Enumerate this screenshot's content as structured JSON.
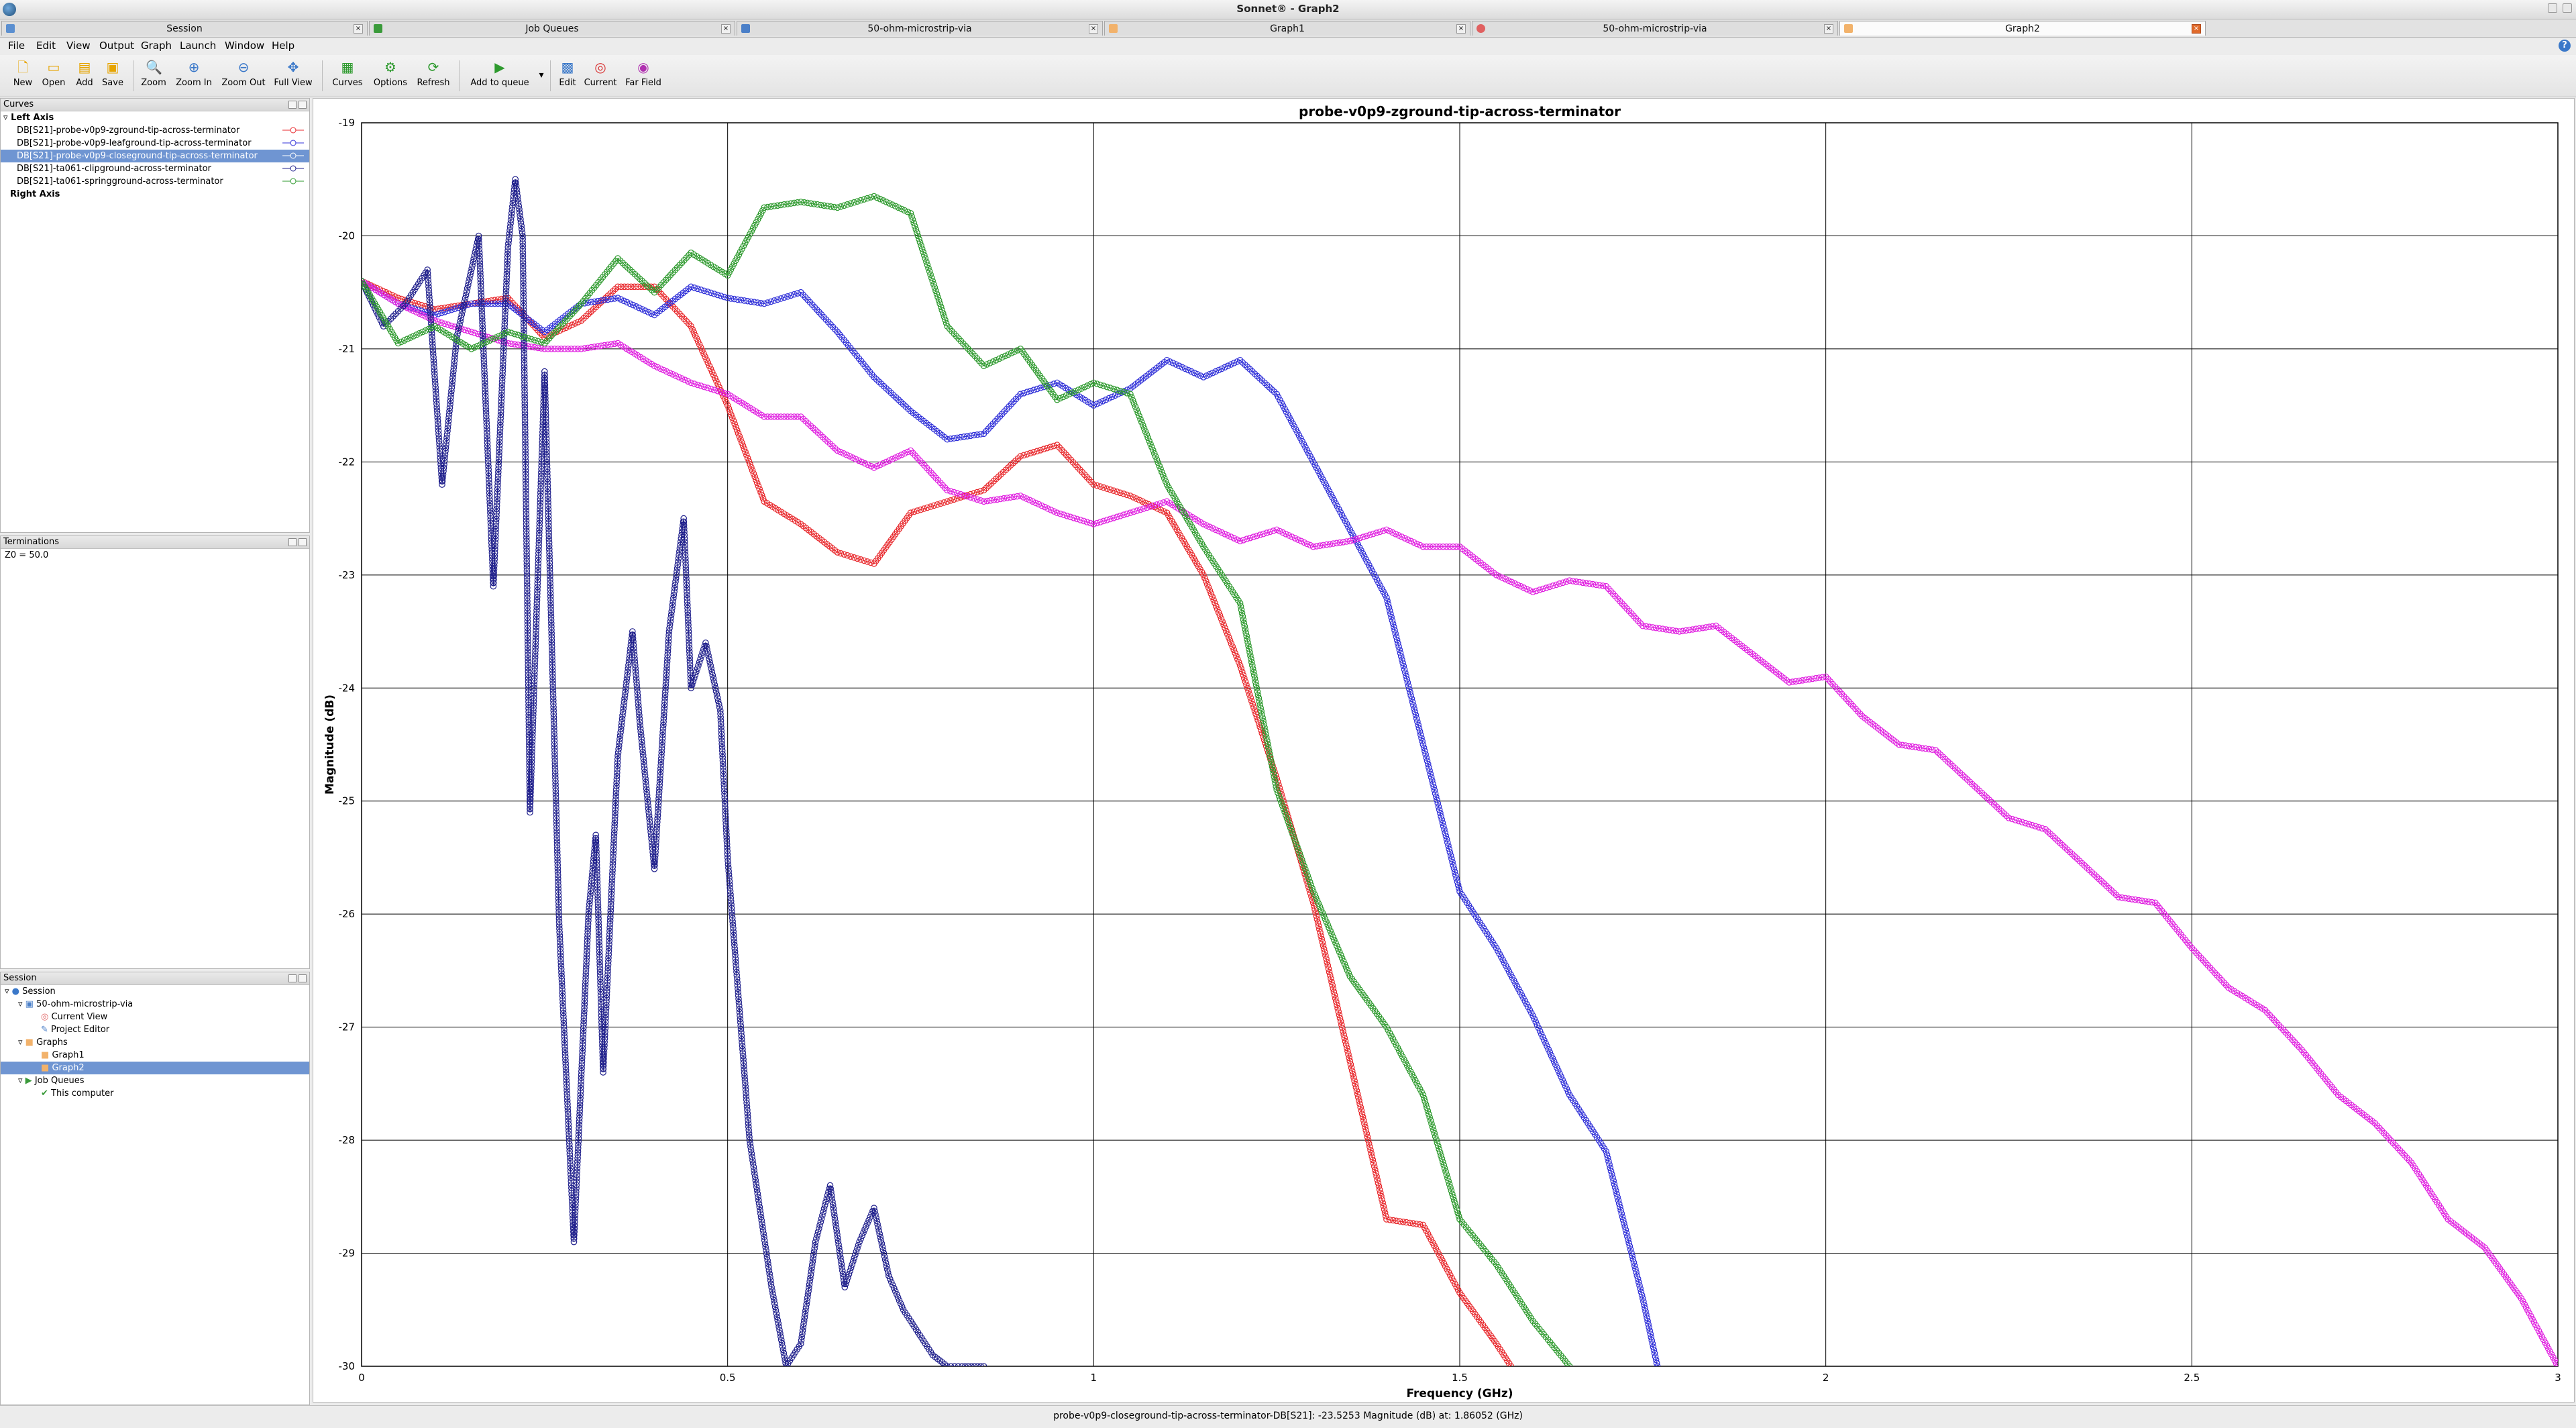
{
  "window": {
    "title": "Sonnet® - Graph2"
  },
  "tabs": [
    {
      "label": "Session",
      "icon": "session-icon",
      "active": false
    },
    {
      "label": "Job Queues",
      "icon": "job-queue-icon",
      "active": false
    },
    {
      "label": "50-ohm-microstrip-via",
      "icon": "project-icon",
      "active": false
    },
    {
      "label": "Graph1",
      "icon": "graph-icon",
      "active": false
    },
    {
      "label": "50-ohm-microstrip-via",
      "icon": "current-view-icon",
      "active": false
    },
    {
      "label": "Graph2",
      "icon": "graph-icon",
      "active": true
    }
  ],
  "menu": [
    "File",
    "Edit",
    "View",
    "Output",
    "Graph",
    "Launch",
    "Window",
    "Help"
  ],
  "toolbar": [
    {
      "label": "New",
      "icon": "new-file-icon"
    },
    {
      "label": "Open",
      "icon": "open-folder-icon"
    },
    {
      "label": "Add",
      "icon": "add-folder-icon"
    },
    {
      "label": "Save",
      "icon": "save-icon"
    },
    {
      "label": "Zoom",
      "icon": "zoom-icon"
    },
    {
      "label": "Zoom In",
      "icon": "zoom-in-icon"
    },
    {
      "label": "Zoom Out",
      "icon": "zoom-out-icon"
    },
    {
      "label": "Full View",
      "icon": "full-view-icon"
    },
    {
      "label": "Curves",
      "icon": "curves-icon"
    },
    {
      "label": "Options",
      "icon": "options-icon"
    },
    {
      "label": "Refresh",
      "icon": "refresh-icon"
    },
    {
      "label": "Add to queue",
      "icon": "add-to-queue-icon"
    },
    {
      "label": "Edit",
      "icon": "edit-icon"
    },
    {
      "label": "Current",
      "icon": "current-icon"
    },
    {
      "label": "Far Field",
      "icon": "far-field-icon"
    }
  ],
  "curves_panel": {
    "title": "Curves",
    "left_axis_label": "Left Axis",
    "right_axis_label": "Right Axis",
    "items": [
      {
        "label": "DB[S21]-probe-v0p9-zground-tip-across-terminator",
        "color": "#e8282c",
        "selected": false
      },
      {
        "label": "DB[S21]-probe-v0p9-leafground-tip-across-terminator",
        "color": "#3030d8",
        "selected": false
      },
      {
        "label": "DB[S21]-probe-v0p9-closeground-tip-across-terminator",
        "color": "#e020e0",
        "selected": true
      },
      {
        "label": "DB[S21]-ta061-clipground-across-terminator",
        "color": "#20208c",
        "selected": false
      },
      {
        "label": "DB[S21]-ta061-springground-across-terminator",
        "color": "#2e9a2e",
        "selected": false
      }
    ]
  },
  "terminations_panel": {
    "title": "Terminations",
    "text": "Z0 = 50.0"
  },
  "session_panel": {
    "title": "Session",
    "tree": [
      {
        "label": "Session",
        "depth": 0,
        "icon": "session-icon",
        "selected": false
      },
      {
        "label": "50-ohm-microstrip-via",
        "depth": 1,
        "icon": "project-icon",
        "selected": false
      },
      {
        "label": "Current View",
        "depth": 2,
        "icon": "current-view-icon",
        "selected": false
      },
      {
        "label": "Project Editor",
        "depth": 2,
        "icon": "project-editor-icon",
        "selected": false
      },
      {
        "label": "Graphs",
        "depth": 1,
        "icon": "graphs-folder-icon",
        "selected": false
      },
      {
        "label": "Graph1",
        "depth": 2,
        "icon": "graph-icon",
        "selected": false
      },
      {
        "label": "Graph2",
        "depth": 2,
        "icon": "graph-icon",
        "selected": true
      },
      {
        "label": "Job Queues",
        "depth": 1,
        "icon": "job-queue-icon",
        "selected": false
      },
      {
        "label": "This computer",
        "depth": 2,
        "icon": "computer-check-icon",
        "selected": false
      }
    ]
  },
  "status_bar": {
    "text": "probe-v0p9-closeground-tip-across-terminator-DB[S21]: -23.5253 Magnitude (dB) at: 1.86052 (GHz)"
  },
  "chart_data": {
    "type": "line",
    "title": "probe-v0p9-zground-tip-across-terminator",
    "xlabel": "Frequency (GHz)",
    "ylabel": "Magnitude (dB)",
    "xlim": [
      0,
      3
    ],
    "ylim": [
      -30,
      -19
    ],
    "xticks": [
      "0",
      "0.5",
      "1",
      "1.5",
      "2",
      "2.5",
      "3"
    ],
    "yticks": [
      "-19",
      "-20",
      "-21",
      "-22",
      "-23",
      "-24",
      "-25",
      "-26",
      "-27",
      "-28",
      "-29",
      "-30"
    ],
    "grid": true,
    "marker": "open-circle",
    "series": [
      {
        "name": "DB[S21]-probe-v0p9-zground-tip-across-terminator",
        "color": "#e8282c",
        "x": [
          0,
          0.05,
          0.1,
          0.15,
          0.2,
          0.25,
          0.3,
          0.35,
          0.4,
          0.45,
          0.5,
          0.55,
          0.6,
          0.65,
          0.7,
          0.75,
          0.8,
          0.85,
          0.9,
          0.95,
          1.0,
          1.05,
          1.1,
          1.15,
          1.2,
          1.25,
          1.3,
          1.35,
          1.4,
          1.45,
          1.5,
          1.55,
          1.57
        ],
        "y": [
          -20.4,
          -20.55,
          -20.65,
          -20.6,
          -20.55,
          -20.9,
          -20.75,
          -20.45,
          -20.45,
          -20.8,
          -21.5,
          -22.35,
          -22.55,
          -22.8,
          -22.9,
          -22.45,
          -22.35,
          -22.25,
          -21.95,
          -21.85,
          -22.2,
          -22.3,
          -22.45,
          -23.0,
          -23.8,
          -24.8,
          -25.9,
          -27.3,
          -28.7,
          -28.75,
          -29.35,
          -29.8,
          -30.0
        ]
      },
      {
        "name": "DB[S21]-probe-v0p9-leafground-tip-across-terminator",
        "color": "#3030d8",
        "x": [
          0,
          0.05,
          0.1,
          0.15,
          0.2,
          0.25,
          0.3,
          0.35,
          0.4,
          0.45,
          0.5,
          0.55,
          0.6,
          0.65,
          0.7,
          0.75,
          0.8,
          0.85,
          0.9,
          0.95,
          1.0,
          1.05,
          1.1,
          1.15,
          1.2,
          1.25,
          1.3,
          1.35,
          1.4,
          1.45,
          1.5,
          1.55,
          1.6,
          1.65,
          1.7,
          1.75,
          1.77
        ],
        "y": [
          -20.4,
          -20.6,
          -20.7,
          -20.6,
          -20.6,
          -20.85,
          -20.6,
          -20.55,
          -20.7,
          -20.45,
          -20.55,
          -20.6,
          -20.5,
          -20.85,
          -21.25,
          -21.55,
          -21.8,
          -21.75,
          -21.4,
          -21.3,
          -21.5,
          -21.35,
          -21.1,
          -21.25,
          -21.1,
          -21.4,
          -22.0,
          -22.6,
          -23.2,
          -24.5,
          -25.8,
          -26.3,
          -26.9,
          -27.6,
          -28.1,
          -29.4,
          -30.0
        ]
      },
      {
        "name": "DB[S21]-probe-v0p9-closeground-tip-across-terminator",
        "color": "#e020e0",
        "x": [
          0,
          0.05,
          0.1,
          0.15,
          0.2,
          0.25,
          0.3,
          0.35,
          0.4,
          0.45,
          0.5,
          0.55,
          0.6,
          0.65,
          0.7,
          0.75,
          0.8,
          0.85,
          0.9,
          0.95,
          1.0,
          1.05,
          1.1,
          1.15,
          1.2,
          1.25,
          1.3,
          1.35,
          1.4,
          1.45,
          1.5,
          1.55,
          1.6,
          1.65,
          1.7,
          1.75,
          1.8,
          1.85,
          1.9,
          1.95,
          2.0,
          2.05,
          2.1,
          2.15,
          2.2,
          2.25,
          2.3,
          2.35,
          2.4,
          2.45,
          2.5,
          2.55,
          2.6,
          2.65,
          2.7,
          2.75,
          2.8,
          2.85,
          2.9,
          2.95,
          3.0
        ],
        "y": [
          -20.4,
          -20.6,
          -20.75,
          -20.85,
          -20.95,
          -21.0,
          -21.0,
          -20.95,
          -21.15,
          -21.3,
          -21.4,
          -21.6,
          -21.6,
          -21.9,
          -22.05,
          -21.9,
          -22.25,
          -22.35,
          -22.3,
          -22.45,
          -22.55,
          -22.45,
          -22.35,
          -22.55,
          -22.7,
          -22.6,
          -22.75,
          -22.7,
          -22.6,
          -22.75,
          -22.75,
          -23.0,
          -23.15,
          -23.05,
          -23.1,
          -23.45,
          -23.5,
          -23.45,
          -23.7,
          -23.95,
          -23.9,
          -24.25,
          -24.5,
          -24.55,
          -24.85,
          -25.15,
          -25.25,
          -25.55,
          -25.85,
          -25.9,
          -26.3,
          -26.65,
          -26.85,
          -27.2,
          -27.6,
          -27.85,
          -28.2,
          -28.7,
          -28.95,
          -29.4,
          -30.0
        ]
      },
      {
        "name": "DB[S21]-ta061-clipground-across-terminator",
        "color": "#20208c",
        "x": [
          0,
          0.03,
          0.06,
          0.09,
          0.11,
          0.13,
          0.16,
          0.18,
          0.2,
          0.21,
          0.22,
          0.23,
          0.25,
          0.27,
          0.29,
          0.31,
          0.32,
          0.33,
          0.35,
          0.37,
          0.38,
          0.4,
          0.42,
          0.44,
          0.45,
          0.47,
          0.49,
          0.5,
          0.53,
          0.56,
          0.58,
          0.6,
          0.62,
          0.64,
          0.66,
          0.68,
          0.7,
          0.72,
          0.74,
          0.76,
          0.78,
          0.8,
          0.82,
          0.85
        ],
        "y": [
          -20.4,
          -20.8,
          -20.6,
          -20.3,
          -22.2,
          -20.9,
          -20.0,
          -23.1,
          -20.1,
          -19.5,
          -20.0,
          -25.1,
          -21.2,
          -26.1,
          -28.9,
          -26.0,
          -25.3,
          -27.4,
          -24.6,
          -23.5,
          -24.3,
          -25.6,
          -23.5,
          -22.5,
          -24.0,
          -23.6,
          -24.2,
          -25.5,
          -28.0,
          -29.3,
          -30.0,
          -29.8,
          -28.9,
          -28.4,
          -29.3,
          -28.9,
          -28.6,
          -29.2,
          -29.5,
          -29.7,
          -29.9,
          -30.0,
          -30.0,
          -30.0
        ]
      },
      {
        "name": "DB[S21]-ta061-springground-across-terminator",
        "color": "#2e9a2e",
        "x": [
          0,
          0.05,
          0.1,
          0.15,
          0.2,
          0.25,
          0.3,
          0.35,
          0.4,
          0.45,
          0.5,
          0.55,
          0.6,
          0.65,
          0.7,
          0.75,
          0.8,
          0.85,
          0.9,
          0.95,
          1.0,
          1.05,
          1.1,
          1.15,
          1.2,
          1.25,
          1.3,
          1.35,
          1.4,
          1.45,
          1.5,
          1.55,
          1.6,
          1.65
        ],
        "y": [
          -20.4,
          -20.95,
          -20.8,
          -21.0,
          -20.85,
          -20.95,
          -20.6,
          -20.2,
          -20.5,
          -20.15,
          -20.35,
          -19.75,
          -19.7,
          -19.75,
          -19.65,
          -19.8,
          -20.8,
          -21.15,
          -21.0,
          -21.45,
          -21.3,
          -21.4,
          -22.2,
          -22.75,
          -23.25,
          -24.9,
          -25.8,
          -26.55,
          -27.0,
          -27.6,
          -28.7,
          -29.1,
          -29.6,
          -30.0
        ]
      }
    ]
  }
}
